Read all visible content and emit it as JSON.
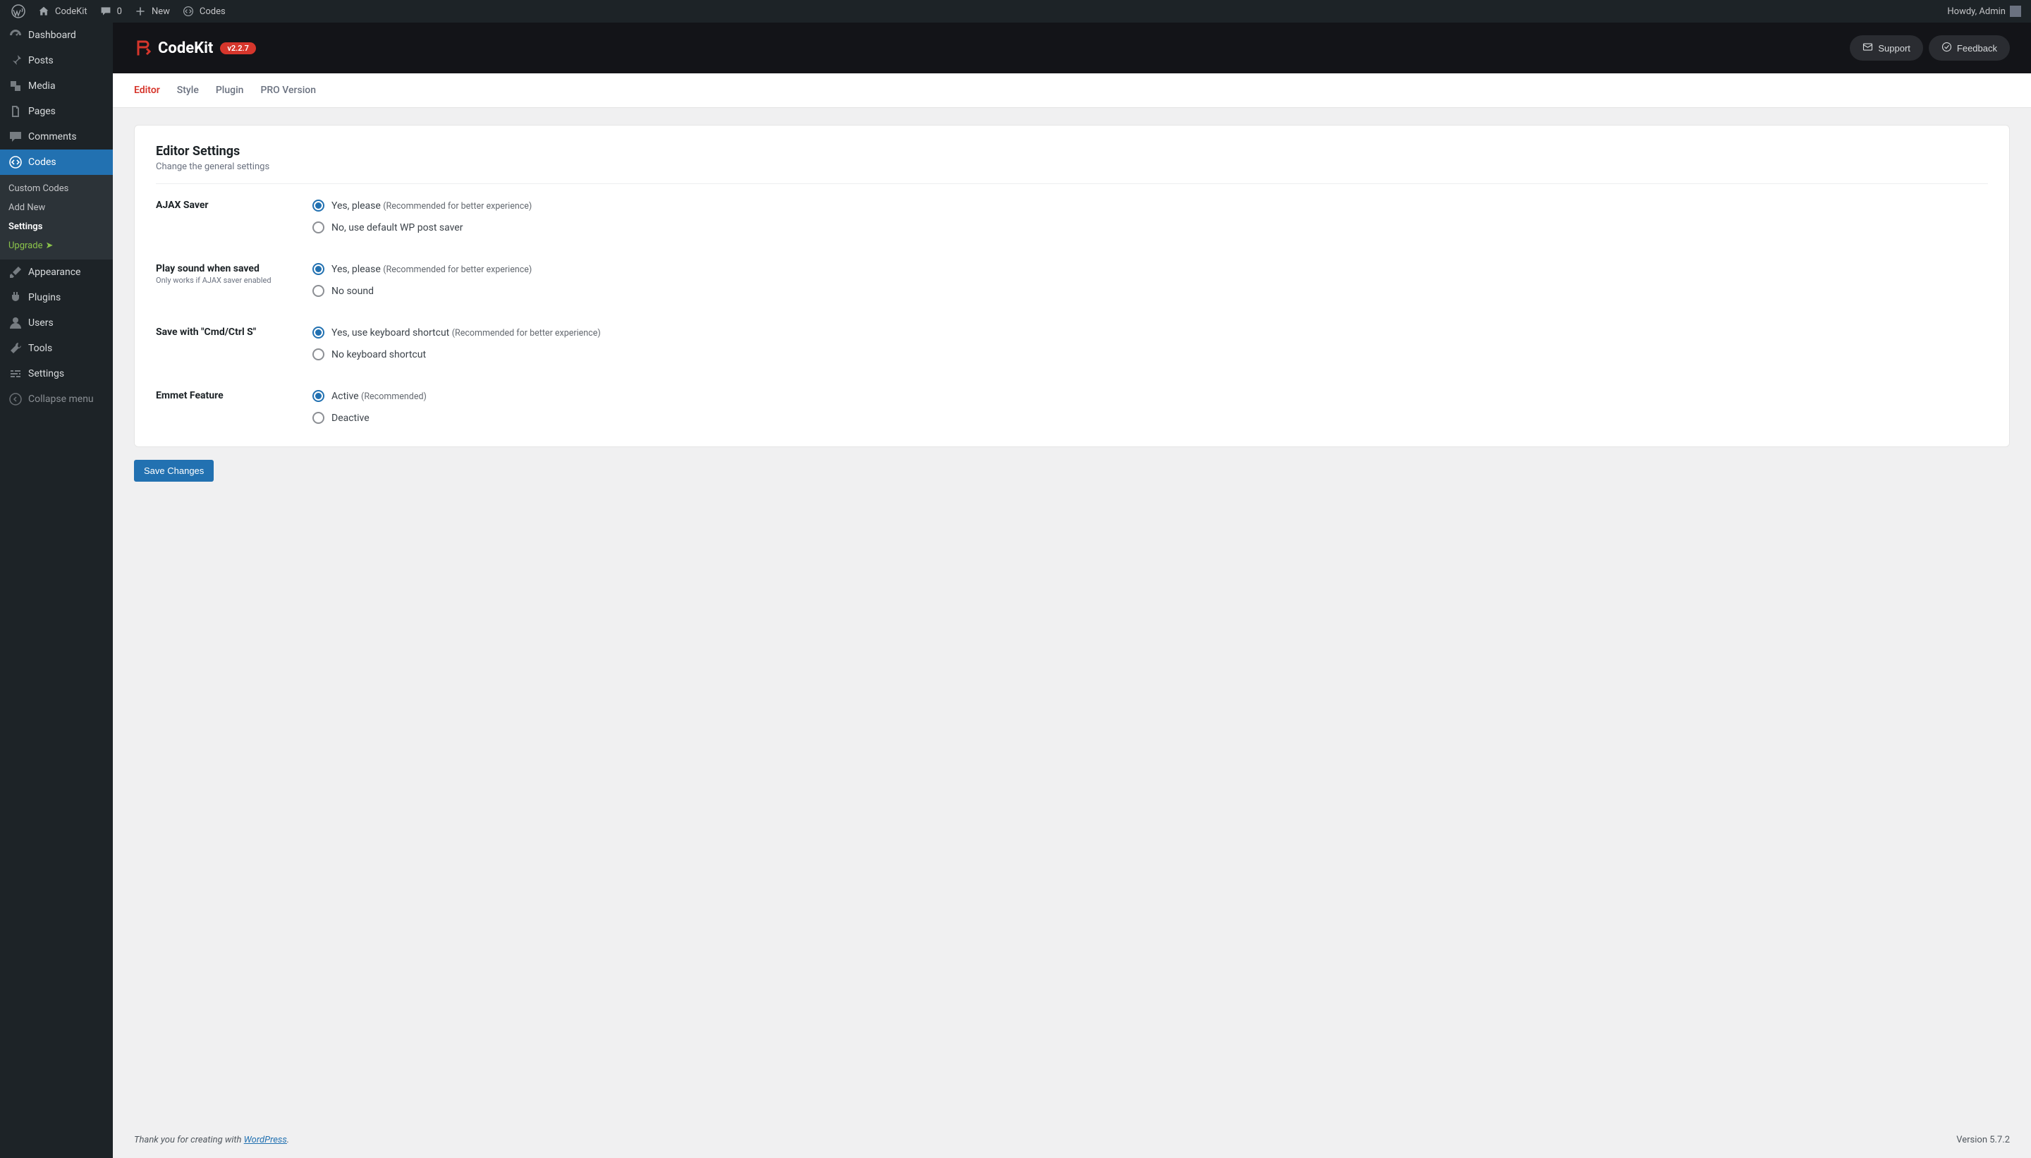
{
  "adminbar": {
    "site_name": "CodeKit",
    "comments": "0",
    "new": "New",
    "codes": "Codes",
    "howdy": "Howdy, Admin"
  },
  "sidebar": {
    "items": [
      {
        "label": "Dashboard"
      },
      {
        "label": "Posts"
      },
      {
        "label": "Media"
      },
      {
        "label": "Pages"
      },
      {
        "label": "Comments"
      },
      {
        "label": "Codes"
      },
      {
        "label": "Appearance"
      },
      {
        "label": "Plugins"
      },
      {
        "label": "Users"
      },
      {
        "label": "Tools"
      },
      {
        "label": "Settings"
      }
    ],
    "submenu": [
      {
        "label": "Custom Codes"
      },
      {
        "label": "Add New"
      },
      {
        "label": "Settings"
      },
      {
        "label": "Upgrade"
      }
    ],
    "collapse": "Collapse menu"
  },
  "header": {
    "brand": "CodeKit",
    "version": "v2.2.7",
    "support": "Support",
    "feedback": "Feedback"
  },
  "tabs": [
    "Editor",
    "Style",
    "Plugin",
    "PRO Version"
  ],
  "card": {
    "title": "Editor Settings",
    "subtitle": "Change the general settings"
  },
  "settings": [
    {
      "label": "AJAX Saver",
      "hint": "",
      "options": [
        {
          "text": "Yes, please",
          "note": "(Recommended for better experience)",
          "checked": true
        },
        {
          "text": "No, use default WP post saver",
          "note": "",
          "checked": false
        }
      ]
    },
    {
      "label": "Play sound when saved",
      "hint": "Only works if AJAX saver enabled",
      "options": [
        {
          "text": "Yes, please",
          "note": "(Recommended for better experience)",
          "checked": true
        },
        {
          "text": "No sound",
          "note": "",
          "checked": false
        }
      ]
    },
    {
      "label": "Save with \"Cmd/Ctrl S\"",
      "hint": "",
      "options": [
        {
          "text": "Yes, use keyboard shortcut",
          "note": "(Recommended for better experience)",
          "checked": true
        },
        {
          "text": "No keyboard shortcut",
          "note": "",
          "checked": false
        }
      ]
    },
    {
      "label": "Emmet Feature",
      "hint": "",
      "options": [
        {
          "text": "Active",
          "note": "(Recommended)",
          "checked": true
        },
        {
          "text": "Deactive",
          "note": "",
          "checked": false
        }
      ]
    }
  ],
  "save": "Save Changes",
  "footer": {
    "thanks_pre": "Thank you for creating with ",
    "wp": "WordPress",
    "dot": ".",
    "version": "Version 5.7.2"
  }
}
